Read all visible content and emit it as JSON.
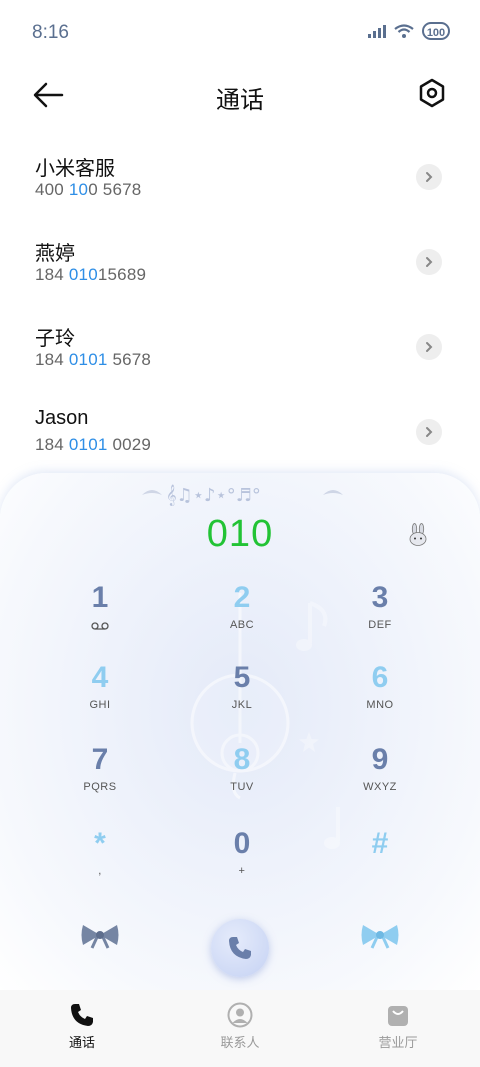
{
  "status_bar": {
    "time": "8:16",
    "battery": "100"
  },
  "header": {
    "title": "通话"
  },
  "contacts": [
    {
      "name": "小米客服",
      "number_parts": [
        "400",
        " ",
        "10",
        "0 5678"
      ]
    },
    {
      "name": "燕婷",
      "number_parts": [
        "184 ",
        "010",
        "",
        "15689"
      ]
    },
    {
      "name": "子玲",
      "number_parts": [
        "184 ",
        "0101",
        "",
        " 5678"
      ]
    },
    {
      "name": "Jason",
      "number_parts": [
        "184 ",
        "0101",
        "",
        " 0029"
      ]
    }
  ],
  "dialer": {
    "dialed_number": "010",
    "keys": [
      {
        "digit": "1",
        "letters": "",
        "icon": "voicemail-icon"
      },
      {
        "digit": "2",
        "letters": "ABC"
      },
      {
        "digit": "3",
        "letters": "DEF"
      },
      {
        "digit": "4",
        "letters": "GHI"
      },
      {
        "digit": "5",
        "letters": "JKL"
      },
      {
        "digit": "6",
        "letters": "MNO"
      },
      {
        "digit": "7",
        "letters": "PQRS"
      },
      {
        "digit": "8",
        "letters": "TUV"
      },
      {
        "digit": "9",
        "letters": "WXYZ"
      },
      {
        "digit": "*",
        "letters": ","
      },
      {
        "digit": "0",
        "letters": "+"
      },
      {
        "digit": "#",
        "letters": ""
      }
    ]
  },
  "bottom_nav": [
    {
      "label": "通话",
      "icon": "phone-icon",
      "active": true
    },
    {
      "label": "联系人",
      "icon": "person-icon",
      "active": false
    },
    {
      "label": "营业厅",
      "icon": "bag-icon",
      "active": false
    }
  ],
  "colors": {
    "dialed": "#22c335",
    "highlight": "#2e8ee6",
    "key_dark": "#6a7faa",
    "key_light": "#8fcdf0"
  }
}
